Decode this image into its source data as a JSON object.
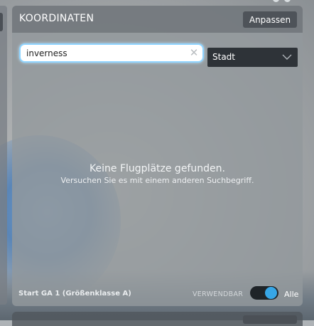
{
  "panel": {
    "title": "KOORDINATEN",
    "adjust_label": "Anpassen"
  },
  "search": {
    "value": "inverness",
    "placeholder": ""
  },
  "filter": {
    "selected": "Stadt"
  },
  "empty_state": {
    "title": "Keine Flugplätze gefunden.",
    "subtitle": "Versuchen Sie es mit einem anderen Suchbegriff."
  },
  "footer": {
    "start_label": "Start GA 1 (Größenklasse A)",
    "usable_label": "VERWENDBAR",
    "all_label": "Alle",
    "toggle_on": true
  },
  "colors": {
    "accent": "#37a6e6",
    "search_focus": "#8fd4ff"
  }
}
